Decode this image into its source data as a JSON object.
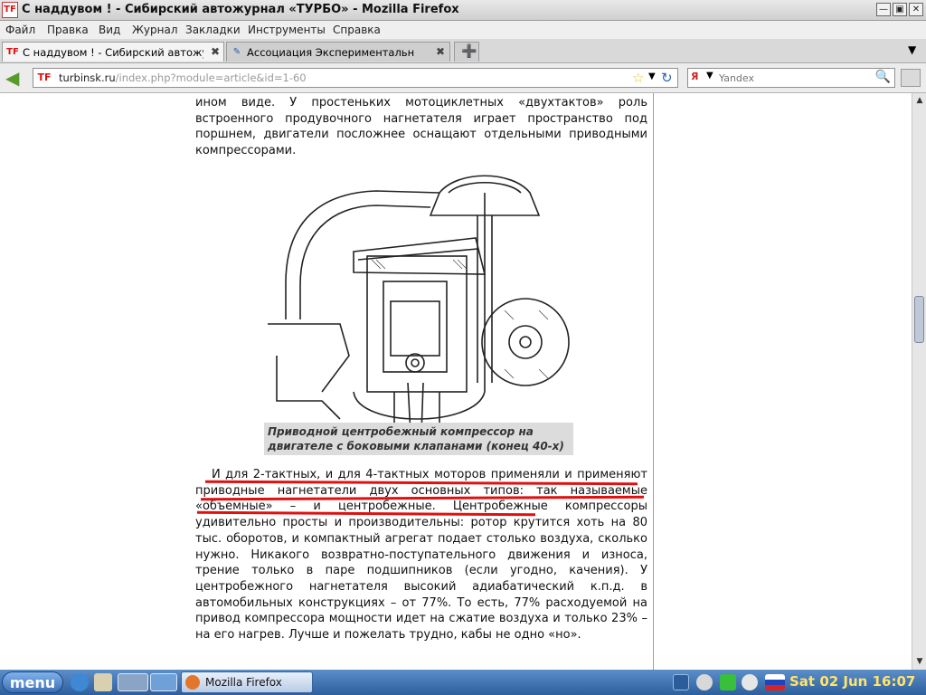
{
  "window": {
    "title": "С наддувом ! - Сибирский автожурнал «ТУРБО» - Mozilla Firefox",
    "app_logo": "TF"
  },
  "menubar": {
    "items": [
      "Файл",
      "Правка",
      "Вид",
      "Журнал",
      "Закладки",
      "Инструменты",
      "Справка"
    ]
  },
  "tabs": [
    {
      "label": "С наддувом ! - Сибирский автожу",
      "active": true
    },
    {
      "label": "Ассоциация Экспериментальн",
      "active": false
    }
  ],
  "navbar": {
    "url_host": "turbinsk.ru",
    "url_path": "/index.php?module=article&id=1-60",
    "search_placeholder": "Yandex"
  },
  "article": {
    "paragraph_top": "ином виде. У простеньких мотоциклетных «двухтактов» роль встроенного продувочного нагнетателя играет пространство под поршнем, двигатели посложнее оснащают отдельными приводными компрессорами.",
    "caption": "Приводной центробежный компрессор на двигателе с боковыми клапанами (конец 40-х)",
    "paragraph_main": "И для 2-тактных, и для 4-тактных моторов применяли и применяют приводные нагнетатели двух основных типов: так называемые «объемные» – и центробежные. Центробежные компрессоры удивительно просты и производительны: ротор крутится хоть на 80 тыс. оборотов, и компактный агрегат подает столько воздуха, сколько нужно. Никакого возвратно-поступательного движения и износа, трение только в паре подшипников (если угодно, качения). У центробежного нагнетателя высокий адиабатический к.п.д. в автомобильных конструкциях – от 77%. То есть, 77% расходуемой на привод компрессора мощности идет на сжатие воздуха и только 23% – на его нагрев. Лучше и пожелать трудно, кабы не одно «но»."
  },
  "taskbar": {
    "menu_label": "menu",
    "window_label": "Mozilla Firefox",
    "clock": "Sat 02 Jun 16:07"
  },
  "colors": {
    "underline": "#e01010",
    "taskbar": "#2d5f9e",
    "clock": "#ffe36b"
  }
}
